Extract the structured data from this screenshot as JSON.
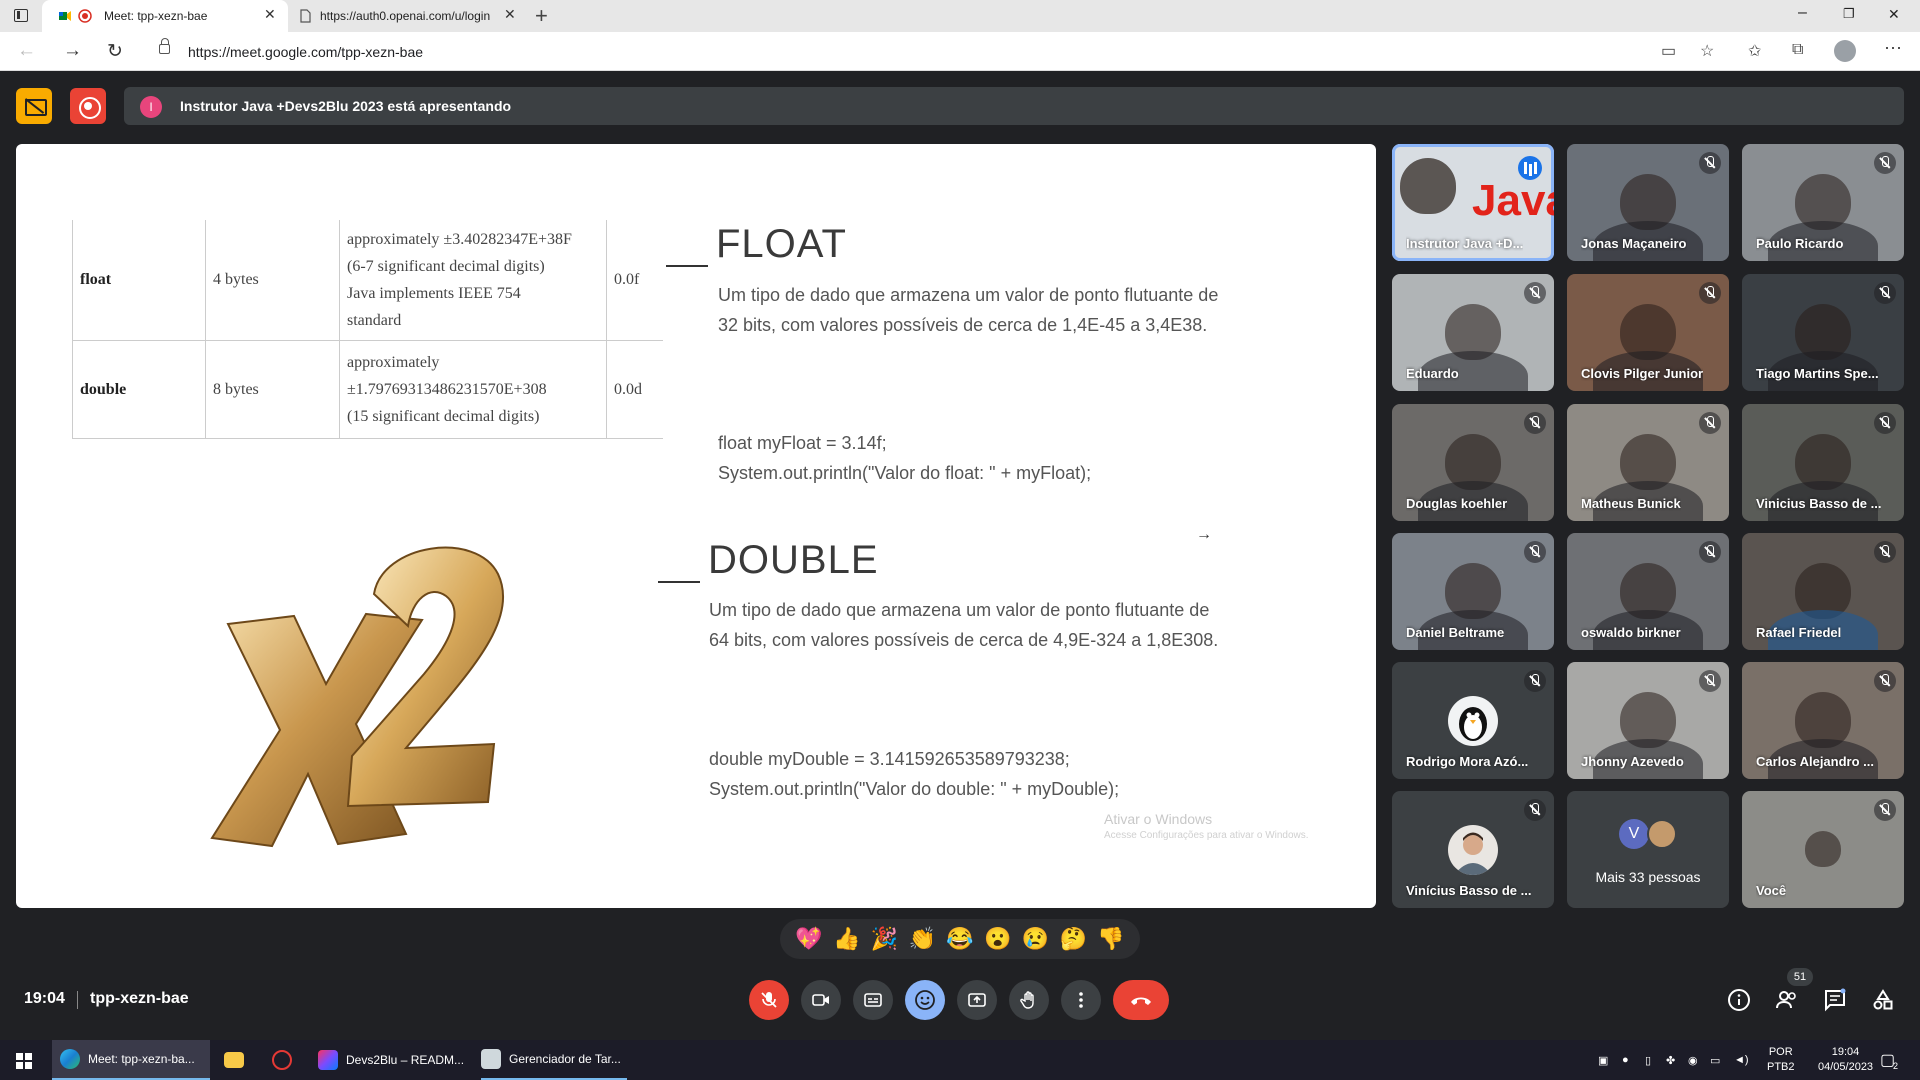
{
  "browser": {
    "tabs": [
      {
        "title": "Meet: tpp-xezn-bae",
        "active": true
      },
      {
        "title": "https://auth0.openai.com/u/login",
        "active": false
      }
    ],
    "url": "https://meet.google.com/tpp-xezn-bae"
  },
  "meet": {
    "presenting_initial": "I",
    "presenting_text": "Instrutor Java +Devs2Blu 2023 está apresentando",
    "clock": "19:04",
    "meeting_code": "tpp-xezn-bae",
    "people_count": "51"
  },
  "slide": {
    "table": {
      "rows": [
        {
          "type": "float",
          "size": "4 bytes",
          "range": [
            "approximately ±3.40282347E+38F",
            "(6-7 significant decimal digits)",
            "Java implements IEEE 754",
            "standard"
          ],
          "default": "0.0f"
        },
        {
          "type": "double",
          "size": "8 bytes",
          "range": [
            "approximately",
            "±1.79769313486231570E+308",
            "(15 significant decimal digits)"
          ],
          "default": "0.0d"
        }
      ]
    },
    "float": {
      "title": "FLOAT",
      "description": "Um tipo de dado que armazena um valor de ponto flutuante de 32 bits, com valores possíveis de cerca de 1,4E-45 a 3,4E38.",
      "code_line1": "float myFloat = 3.14f;",
      "code_line2": "System.out.println(\"Valor do float: \" + myFloat);"
    },
    "double": {
      "title": "DOUBLE",
      "description": "Um tipo de dado que armazena um valor de ponto flutuante de 64 bits, com valores possíveis de cerca de 4,9E-324 a 1,8E308.",
      "code_line1": "double myDouble = 3.141592653589793238;",
      "code_line2": "System.out.println(\"Valor do double: \" + myDouble);"
    },
    "watermark_title": "Ativar o Windows",
    "watermark_subtitle": "Acesse Configurações para ativar o Windows."
  },
  "participants": [
    {
      "name": "Instrutor Java +D...",
      "tone": "#5a6470"
    },
    {
      "name": "Jonas Maçaneiro",
      "tone": "#6a7078"
    },
    {
      "name": "Paulo Ricardo",
      "tone": "#8a8e92"
    },
    {
      "name": "Eduardo",
      "tone": "#b0b4b6"
    },
    {
      "name": "Clovis Pilger Junior",
      "tone": "#7a5a48"
    },
    {
      "name": "Tiago Martins Spe...",
      "tone": "#3a3f44"
    },
    {
      "name": "Douglas koehler",
      "tone": "#6c6a68"
    },
    {
      "name": "Matheus Bunick",
      "tone": "#8e8a84"
    },
    {
      "name": "Vinicius Basso de ...",
      "tone": "#5a5c58"
    },
    {
      "name": "Daniel Beltrame",
      "tone": "#7c828a"
    },
    {
      "name": "oswaldo birkner",
      "tone": "#6e7074"
    },
    {
      "name": "Rafael Friedel",
      "tone": "#5a5450"
    },
    {
      "name": "Rodrigo Mora Azó...",
      "tone": "#3c4043"
    },
    {
      "name": "Jhonny Azevedo",
      "tone": "#a8a8a6"
    },
    {
      "name": "Carlos Alejandro ...",
      "tone": "#7a7068"
    },
    {
      "name": "Vinícius Basso de ...",
      "tone": "#3c4043"
    },
    {
      "name": "Mais 33 pessoas",
      "tone": "#3c4043"
    },
    {
      "name": "Você",
      "tone": "#8c8c88"
    }
  ],
  "more": {
    "initial": "V"
  },
  "reactions": [
    "💖",
    "👍",
    "🎉",
    "👏",
    "😂",
    "😮",
    "😢",
    "🤔",
    "👎"
  ],
  "taskbar": {
    "items": [
      "Meet: tpp-xezn-ba...",
      "Devs2Blu – READM...",
      "Gerenciador de Tar..."
    ],
    "lang": "POR",
    "lang2": "PTB2",
    "time": "19:04",
    "date": "04/05/2023",
    "notif": "2"
  }
}
